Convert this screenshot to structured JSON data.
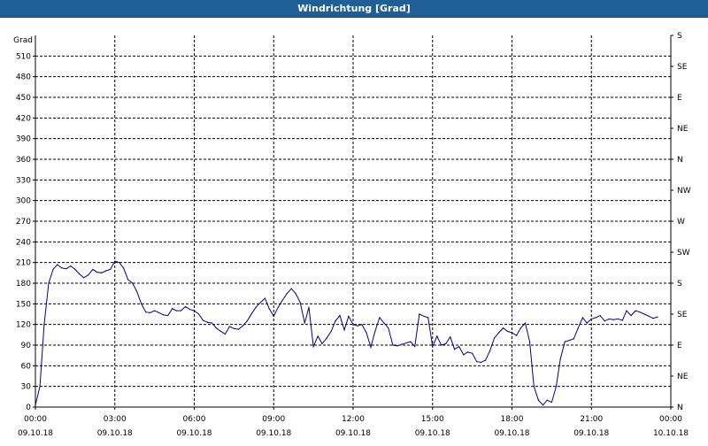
{
  "window": {
    "title": "Windrichtung [Grad]"
  },
  "chart_data": {
    "type": "line",
    "ylabel": "Grad",
    "ylim": [
      0,
      540
    ],
    "grid": true,
    "y_ticks_left": [
      0,
      30,
      60,
      90,
      120,
      150,
      180,
      210,
      240,
      270,
      300,
      330,
      360,
      390,
      420,
      450,
      480,
      510
    ],
    "y_ticks_right": [
      {
        "value": 0,
        "label": "N"
      },
      {
        "value": 45,
        "label": "NE"
      },
      {
        "value": 90,
        "label": "E"
      },
      {
        "value": 135,
        "label": "SE"
      },
      {
        "value": 180,
        "label": "S"
      },
      {
        "value": 225,
        "label": "SW"
      },
      {
        "value": 270,
        "label": "W"
      },
      {
        "value": 315,
        "label": "NW"
      },
      {
        "value": 360,
        "label": "N"
      },
      {
        "value": 405,
        "label": "NE"
      },
      {
        "value": 450,
        "label": "E"
      },
      {
        "value": 495,
        "label": "SE"
      },
      {
        "value": 540,
        "label": "S"
      }
    ],
    "x_ticks": [
      {
        "hour": 0,
        "time": "00:00",
        "date": "09.10.18"
      },
      {
        "hour": 3,
        "time": "03:00",
        "date": "09.10.18"
      },
      {
        "hour": 6,
        "time": "06:00",
        "date": "09.10.18"
      },
      {
        "hour": 9,
        "time": "09:00",
        "date": "09.10.18"
      },
      {
        "hour": 12,
        "time": "12:00",
        "date": "09.10.18"
      },
      {
        "hour": 15,
        "time": "15:00",
        "date": "09.10.18"
      },
      {
        "hour": 18,
        "time": "18:00",
        "date": "09.10.18"
      },
      {
        "hour": 21,
        "time": "21:00",
        "date": "09.10.18"
      },
      {
        "hour": 24,
        "time": "00:00",
        "date": "10.10.18"
      }
    ],
    "series_color": "#00008b",
    "series": [
      {
        "values": [
          [
            0.0,
            3
          ],
          [
            0.17,
            30
          ],
          [
            0.33,
            120
          ],
          [
            0.5,
            180
          ],
          [
            0.67,
            200
          ],
          [
            0.83,
            207
          ],
          [
            1.0,
            202
          ],
          [
            1.17,
            201
          ],
          [
            1.33,
            205
          ],
          [
            1.5,
            200
          ],
          [
            1.67,
            193
          ],
          [
            1.83,
            188
          ],
          [
            2.0,
            192
          ],
          [
            2.17,
            200
          ],
          [
            2.33,
            196
          ],
          [
            2.5,
            195
          ],
          [
            2.67,
            198
          ],
          [
            2.83,
            200
          ],
          [
            3.0,
            212
          ],
          [
            3.17,
            210
          ],
          [
            3.33,
            202
          ],
          [
            3.5,
            185
          ],
          [
            3.67,
            180
          ],
          [
            3.83,
            168
          ],
          [
            4.0,
            150
          ],
          [
            4.17,
            138
          ],
          [
            4.33,
            137
          ],
          [
            4.5,
            140
          ],
          [
            4.67,
            137
          ],
          [
            4.83,
            134
          ],
          [
            5.0,
            133
          ],
          [
            5.17,
            143
          ],
          [
            5.33,
            140
          ],
          [
            5.5,
            140
          ],
          [
            5.67,
            146
          ],
          [
            5.83,
            142
          ],
          [
            6.0,
            140
          ],
          [
            6.17,
            135
          ],
          [
            6.33,
            126
          ],
          [
            6.5,
            123
          ],
          [
            6.67,
            122
          ],
          [
            6.83,
            115
          ],
          [
            7.0,
            110
          ],
          [
            7.17,
            106
          ],
          [
            7.33,
            117
          ],
          [
            7.5,
            114
          ],
          [
            7.67,
            113
          ],
          [
            7.83,
            118
          ],
          [
            8.0,
            125
          ],
          [
            8.17,
            136
          ],
          [
            8.33,
            145
          ],
          [
            8.5,
            152
          ],
          [
            8.67,
            158
          ],
          [
            8.83,
            143
          ],
          [
            9.0,
            132
          ],
          [
            9.17,
            145
          ],
          [
            9.33,
            155
          ],
          [
            9.5,
            165
          ],
          [
            9.67,
            172
          ],
          [
            9.83,
            165
          ],
          [
            10.0,
            152
          ],
          [
            10.17,
            122
          ],
          [
            10.33,
            145
          ],
          [
            10.5,
            88
          ],
          [
            10.67,
            103
          ],
          [
            10.83,
            92
          ],
          [
            11.0,
            100
          ],
          [
            11.17,
            110
          ],
          [
            11.33,
            125
          ],
          [
            11.5,
            133
          ],
          [
            11.67,
            112
          ],
          [
            11.83,
            132
          ],
          [
            12.0,
            120
          ],
          [
            12.17,
            118
          ],
          [
            12.33,
            120
          ],
          [
            12.5,
            108
          ],
          [
            12.67,
            87
          ],
          [
            12.83,
            110
          ],
          [
            13.0,
            130
          ],
          [
            13.17,
            122
          ],
          [
            13.33,
            115
          ],
          [
            13.5,
            90
          ],
          [
            13.67,
            89
          ],
          [
            13.83,
            91
          ],
          [
            14.0,
            93
          ],
          [
            14.17,
            95
          ],
          [
            14.33,
            88
          ],
          [
            14.5,
            135
          ],
          [
            14.67,
            132
          ],
          [
            14.83,
            130
          ],
          [
            15.0,
            88
          ],
          [
            15.17,
            103
          ],
          [
            15.33,
            90
          ],
          [
            15.5,
            92
          ],
          [
            15.67,
            102
          ],
          [
            15.83,
            84
          ],
          [
            16.0,
            88
          ],
          [
            16.17,
            76
          ],
          [
            16.33,
            80
          ],
          [
            16.5,
            78
          ],
          [
            16.67,
            66
          ],
          [
            16.83,
            65
          ],
          [
            17.0,
            68
          ],
          [
            17.17,
            82
          ],
          [
            17.33,
            100
          ],
          [
            17.5,
            108
          ],
          [
            17.67,
            115
          ],
          [
            17.83,
            110
          ],
          [
            18.0,
            108
          ],
          [
            18.17,
            104
          ],
          [
            18.33,
            115
          ],
          [
            18.5,
            122
          ],
          [
            18.67,
            95
          ],
          [
            18.83,
            30
          ],
          [
            19.0,
            10
          ],
          [
            19.17,
            3
          ],
          [
            19.33,
            10
          ],
          [
            19.5,
            7
          ],
          [
            19.67,
            30
          ],
          [
            19.83,
            70
          ],
          [
            20.0,
            95
          ],
          [
            20.17,
            97
          ],
          [
            20.33,
            99
          ],
          [
            20.5,
            115
          ],
          [
            20.67,
            130
          ],
          [
            20.83,
            122
          ],
          [
            21.0,
            128
          ],
          [
            21.17,
            130
          ],
          [
            21.33,
            133
          ],
          [
            21.5,
            125
          ],
          [
            21.67,
            128
          ],
          [
            21.83,
            127
          ],
          [
            22.0,
            128
          ],
          [
            22.17,
            126
          ],
          [
            22.33,
            140
          ],
          [
            22.5,
            133
          ],
          [
            22.67,
            140
          ],
          [
            22.83,
            138
          ],
          [
            23.0,
            135
          ],
          [
            23.17,
            132
          ],
          [
            23.33,
            129
          ],
          [
            23.5,
            131
          ]
        ]
      }
    ]
  }
}
